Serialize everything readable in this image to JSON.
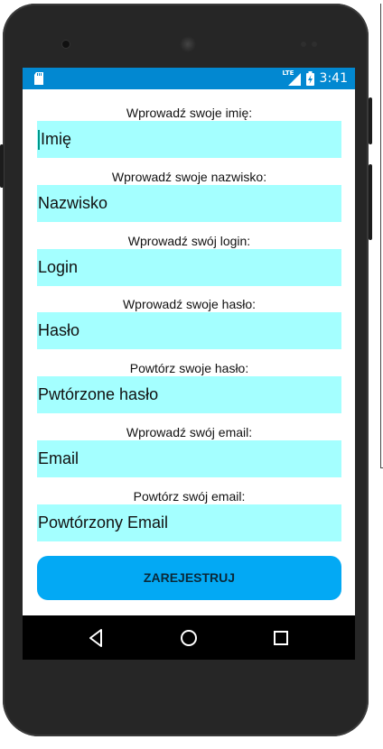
{
  "status_bar": {
    "network": "LTE",
    "time": "3:41"
  },
  "form": {
    "fields": [
      {
        "label": "Wprowadź swoje imię:",
        "placeholder": "Imię"
      },
      {
        "label": "Wprowadź swoje nazwisko:",
        "placeholder": "Nazwisko"
      },
      {
        "label": "Wprowadź swój login:",
        "placeholder": "Login"
      },
      {
        "label": "Wprowadź swoje hasło:",
        "placeholder": "Hasło"
      },
      {
        "label": "Powtórz swoje hasło:",
        "placeholder": "Pwtórzone hasło"
      },
      {
        "label": "Wprowadź swój email:",
        "placeholder": "Email"
      },
      {
        "label": "Powtórz swój email:",
        "placeholder": "Powtórzony Email"
      }
    ],
    "submit_label": "ZAREJESTRUJ"
  },
  "nav_bar": {
    "items": [
      "back-icon",
      "home-icon",
      "recents-icon"
    ]
  },
  "colors": {
    "status_bar": "#0288d1",
    "field_background": "#a4ffff",
    "button": "#03a9f4"
  }
}
